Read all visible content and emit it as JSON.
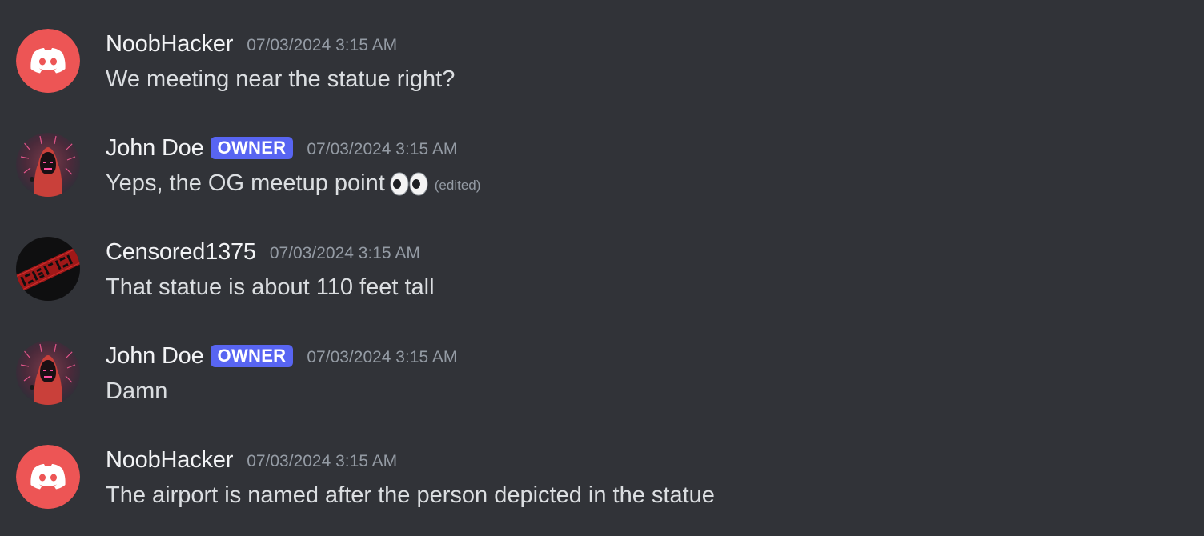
{
  "messages": [
    {
      "author": "NoobHacker",
      "avatar": "discord-logo-avatar",
      "timestamp": "07/03/2024 3:15 AM",
      "badge": null,
      "text": "We meeting near the statue right?"
    },
    {
      "author": "John Doe",
      "avatar": "hooded-figure-avatar",
      "timestamp": "07/03/2024 3:15 AM",
      "badge": "OWNER",
      "text": "Yeps, the OG meetup point",
      "emoji": "eyes-emoji",
      "edited_label": "(edited)"
    },
    {
      "author": "Censored1375",
      "avatar": "censored-stamp-avatar",
      "timestamp": "07/03/2024 3:15 AM",
      "badge": null,
      "text": "That statue is about 110 feet tall"
    },
    {
      "author": "John Doe",
      "avatar": "hooded-figure-avatar",
      "timestamp": "07/03/2024 3:15 AM",
      "badge": "OWNER",
      "text": "Damn"
    },
    {
      "author": "NoobHacker",
      "avatar": "discord-logo-avatar",
      "timestamp": "07/03/2024 3:15 AM",
      "badge": null,
      "text": "The airport is named after the person depicted in the statue"
    }
  ],
  "colors": {
    "background": "#313338",
    "username": "#f2f3f5",
    "message_text": "#dbdee1",
    "timestamp": "#949ba4",
    "owner_badge": "#5865f2",
    "discord_avatar_bg": "#ed5555"
  }
}
